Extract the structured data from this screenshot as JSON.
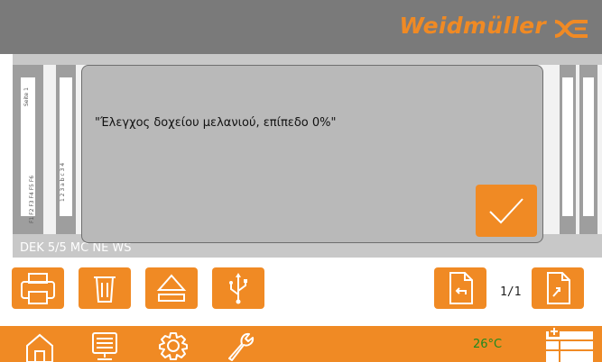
{
  "header": {
    "brand": "Weidmüller",
    "brand_icon": "weidmuller-logo-icon",
    "colors": {
      "bar": "#7a7a7a",
      "accent": "#f08a24"
    }
  },
  "workspace": {
    "strip_labels": [
      "Seite 1",
      "F1 F2 F3 F4 F5 F6",
      "1 2 3 a b c 3 4"
    ],
    "product": "DEK 5/5 MC NE WS"
  },
  "dialog": {
    "message": "\"Έλεγχος δοχείου μελανιού, επίπεδο 0%\"",
    "confirm_icon": "checkmark-icon"
  },
  "toolbar": {
    "buttons": [
      {
        "icon": "printer-icon"
      },
      {
        "icon": "trash-icon"
      },
      {
        "icon": "eject-icon"
      },
      {
        "icon": "usb-icon"
      }
    ],
    "prev_page_icon": "page-back-icon",
    "next_page_icon": "page-forward-icon",
    "page_counter": "1/1"
  },
  "footer": {
    "icons": [
      "home-icon",
      "monitor-icon",
      "settings-gear-icon",
      "wrench-icon",
      "layout-add-icon"
    ],
    "temperature": "26°C",
    "temperature_color": "#1f8a1f"
  }
}
